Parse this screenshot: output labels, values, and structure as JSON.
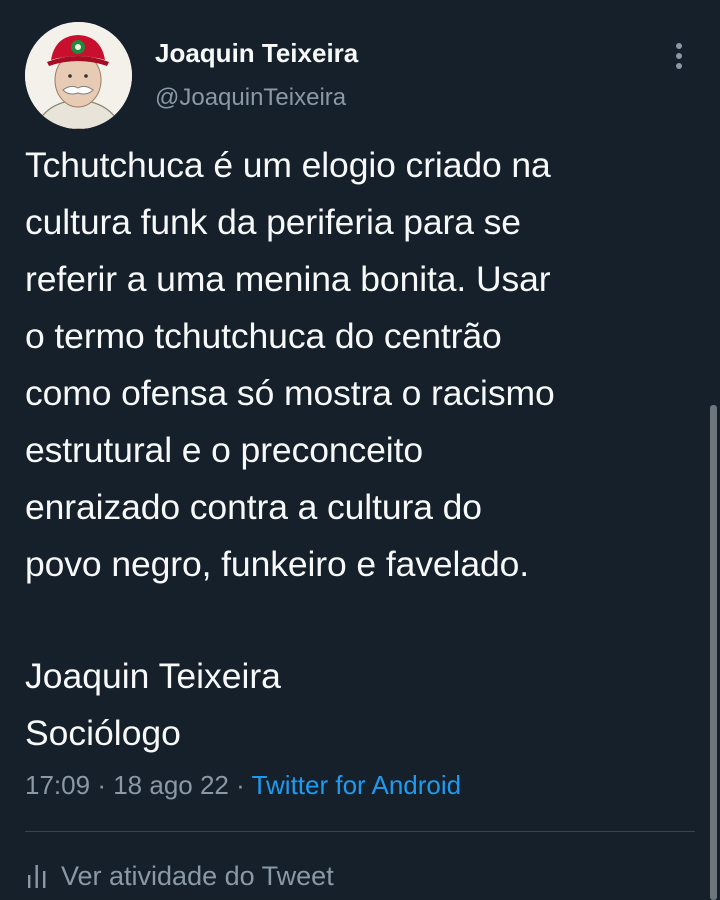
{
  "author": {
    "display_name": "Joaquin Teixeira",
    "handle": "@JoaquinTeixeira",
    "avatar_icon": "avatar-illustration"
  },
  "tweet": {
    "lines": [
      "Tchutchuca é um elogio criado na",
      "cultura funk da periferia para se",
      "referir a uma menina bonita. Usar",
      "o termo tchutchuca do centrão",
      "como ofensa só mostra o racismo",
      "estrutural e o preconceito",
      "enraizado contra a cultura do",
      "povo negro, funkeiro e favelado."
    ],
    "signature": [
      "Joaquin Teixeira",
      "Sociólogo"
    ],
    "time": "17:09",
    "separator": "·",
    "date": "18 ago 22",
    "source": "Twitter for Android"
  },
  "actions": {
    "more_icon": "more-vertical-icon",
    "activity_label": "Ver atividade do Tweet",
    "activity_icon": "bar-chart-icon"
  },
  "colors": {
    "background": "#15202b",
    "text": "#f7f9f9",
    "secondary": "#8b98a5",
    "link": "#1d9bf0",
    "divider": "#38444d"
  }
}
